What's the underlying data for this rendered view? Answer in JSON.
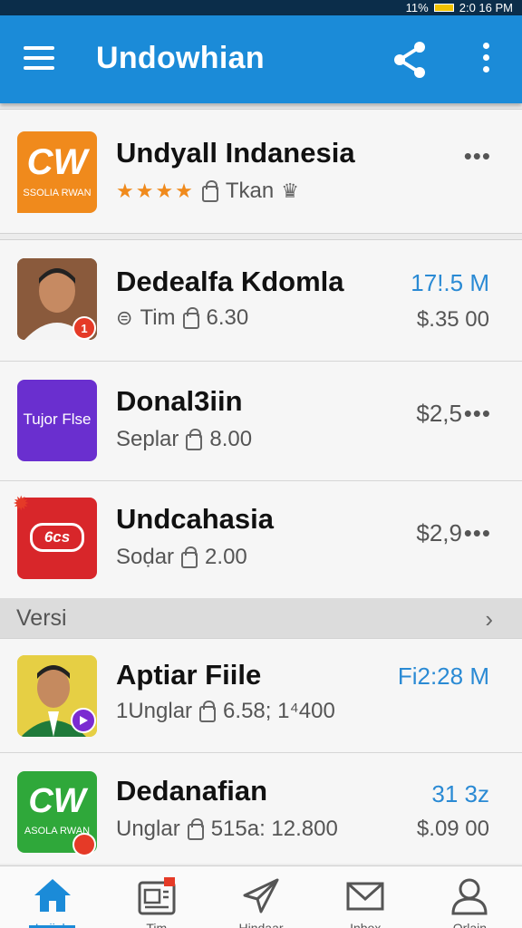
{
  "status_bar": {
    "text": "11%",
    "time": "2:0 16 PM"
  },
  "app_bar": {
    "title": "Undowhian",
    "share_icon": "share-icon",
    "more_icon": "more-vert-icon",
    "menu_icon": "hamburger-icon"
  },
  "featured": {
    "title": "Undyall Indanesia",
    "logo_text": "CW",
    "logo_sub": "SSOLIA RWAN",
    "rating_stars": "★★★★",
    "meta_label": "Tkan",
    "colors": {
      "logo_bg": "#f08a1c",
      "star": "#f08a1c"
    }
  },
  "items": [
    {
      "title": "Dedealfa Kdomla",
      "meta1": "Tim",
      "meta2": "6.30",
      "right_top": "17!.5 M",
      "right_bottom": "$.35 00",
      "badge": "1"
    },
    {
      "title": "Donal3iin",
      "meta1": "Seplar",
      "meta2": "8.00",
      "right_top": "$2,5",
      "logo_text": "Tujor Flse"
    },
    {
      "title": "Undcahasia",
      "meta1": "Soḍar",
      "meta2": "2.00",
      "right_top": "$2,9",
      "logo_text": "6cs"
    }
  ],
  "section": {
    "label": "Versi"
  },
  "items2": [
    {
      "title": "Aptiar Fiile",
      "meta1": "1Unglar",
      "meta2": "6.58; 1⁴400",
      "right_top": "Fi2:28 M"
    },
    {
      "title": "Dedanafian",
      "meta1": "Unglar",
      "meta2": "515a: 12.800",
      "right_top": "31 3z",
      "right_bottom": "$.09 00",
      "logo_text": "CW",
      "logo_sub": "ASOLA RWAN"
    }
  ],
  "bottom_nav": [
    {
      "label": "Lojiah",
      "icon": "home-icon",
      "active": true
    },
    {
      "label": "Tim",
      "icon": "news-icon"
    },
    {
      "label": "Hindaar",
      "icon": "send-icon"
    },
    {
      "label": "Inbox",
      "icon": "mail-icon"
    },
    {
      "label": "Orlain",
      "icon": "profile-icon"
    }
  ]
}
